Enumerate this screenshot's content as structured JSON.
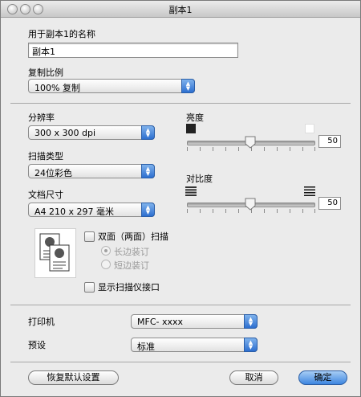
{
  "window": {
    "title": "副本1"
  },
  "name_section": {
    "label": "用于副本1的名称",
    "value": "副本1"
  },
  "ratio_section": {
    "label": "复制比例",
    "selected": "100% 复制"
  },
  "resolution": {
    "label": "分辨率",
    "selected": "300 x 300 dpi"
  },
  "scan_type": {
    "label": "扫描类型",
    "selected": "24位彩色"
  },
  "doc_size": {
    "label": "文档尺寸",
    "selected": "A4  210 x 297 毫米"
  },
  "brightness": {
    "label": "亮度",
    "value": "50",
    "level": 0.5
  },
  "contrast": {
    "label": "对比度",
    "value": "50",
    "level": 0.5
  },
  "duplex": {
    "label": "双面（两面）扫描",
    "checked": false,
    "options": [
      {
        "label": "长边装订",
        "selected": true
      },
      {
        "label": "短边装订",
        "selected": false
      }
    ]
  },
  "show_interface": {
    "label": "显示扫描仪接口",
    "checked": false
  },
  "printer": {
    "label": "打印机",
    "selected": "MFC- xxxx"
  },
  "preset": {
    "label": "预设",
    "selected": "标准"
  },
  "buttons": {
    "restore": "恢复默认设置",
    "cancel": "取消",
    "ok": "确定"
  },
  "colors": {
    "accent": "#3d86e0",
    "window_bg": "#ebebeb"
  }
}
